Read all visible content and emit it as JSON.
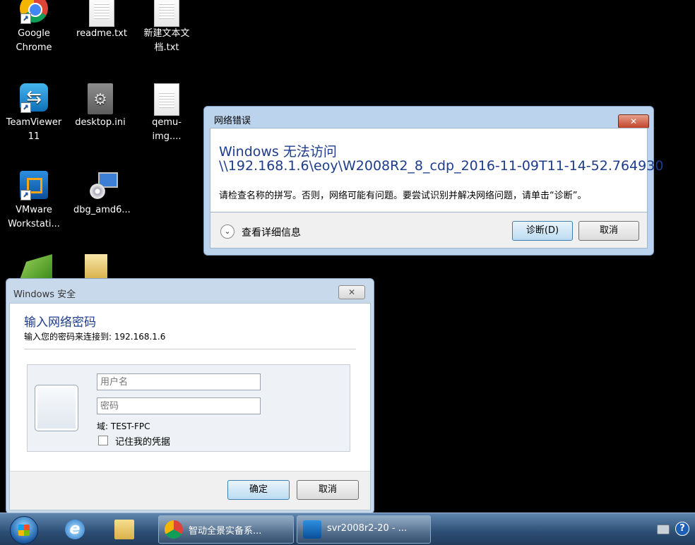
{
  "desktop": {
    "icons": [
      {
        "label": "Google\nChrome"
      },
      {
        "label": "readme.txt"
      },
      {
        "label": "新建文本文\n档.txt"
      },
      {
        "label": "TeamViewer\n11"
      },
      {
        "label": "desktop.ini"
      },
      {
        "label": "qemu-img...."
      },
      {
        "label": "VMware\nWorkstati..."
      },
      {
        "label": "dbg_amd6..."
      }
    ]
  },
  "network_error": {
    "title": "网络错误",
    "close_label": "✕",
    "heading1": "Windows 无法访问",
    "heading2": "\\\\192.168.1.6\\eoy\\W2008R2_8_cdp_2016-11-09T11-14-52.764930",
    "message": "请检查名称的拼写。否则，网络可能有问题。要尝试识别并解决网络问题，请单击“诊断”。",
    "details_label": "查看详细信息",
    "diagnose_button": "诊断(D)",
    "cancel_button": "取消"
  },
  "security": {
    "title": "Windows 安全",
    "close_label": "✕",
    "heading": "输入网络密码",
    "subtitle": "输入您的密码来连接到: 192.168.1.6",
    "username_placeholder": "用户名",
    "password_placeholder": "密码",
    "domain": "域: TEST-FPC",
    "remember_label": "记住我的凭据",
    "ok_button": "确定",
    "cancel_button": "取消"
  },
  "taskbar": {
    "tasks": [
      {
        "label": "智动全景实备系..."
      },
      {
        "label": "svr2008r2-20 - ..."
      }
    ],
    "help_label": "?"
  }
}
